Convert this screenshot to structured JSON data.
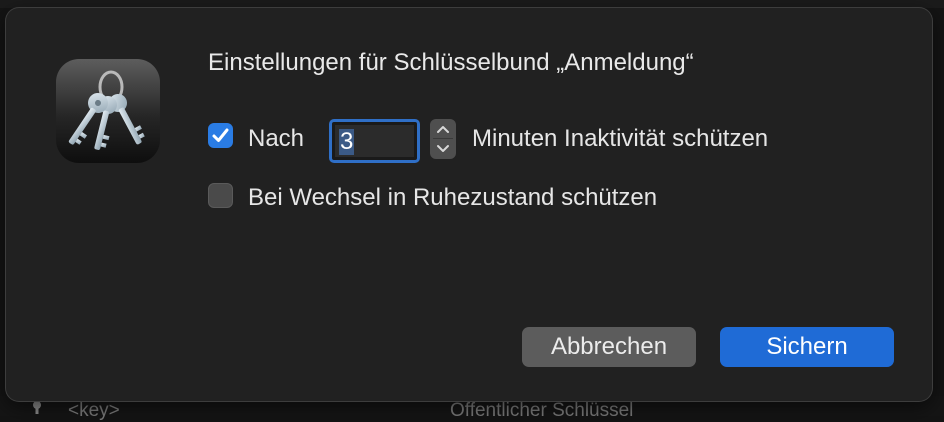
{
  "dialog": {
    "title": "Einstellungen für Schlüsselbund „Anmeldung“",
    "lock_after": {
      "checked": true,
      "prefix_label": "Nach",
      "minutes_value": "3",
      "suffix_label": "Minuten Inaktivität schützen"
    },
    "lock_on_sleep": {
      "checked": false,
      "label": "Bei Wechsel in Ruhezustand schützen"
    },
    "buttons": {
      "cancel_label": "Abbrechen",
      "save_label": "Sichern"
    }
  },
  "background_row": {
    "key_label": "<key>",
    "type_label": "Öffentlicher Schlüssel"
  },
  "colors": {
    "accent": "#1f6bd6",
    "checkbox_on": "#2a7ce4",
    "dialog_bg": "#212121"
  },
  "icons": [
    "keychain-app-icon",
    "checkmark-icon",
    "chevron-up-icon",
    "chevron-down-icon",
    "key-icon"
  ]
}
